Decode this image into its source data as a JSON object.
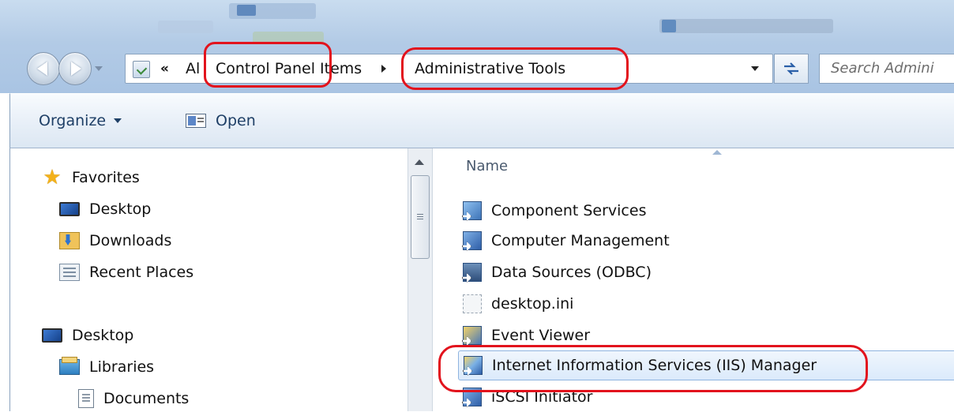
{
  "address_bar": {
    "overflow_chevron": "«",
    "crumbs": [
      "Al",
      "Control Panel Items",
      "Administrative Tools"
    ],
    "search_placeholder": "Search Admini"
  },
  "command_bar": {
    "organize_label": "Organize",
    "open_label": "Open"
  },
  "nav_pane": {
    "items": [
      {
        "label": "Favorites",
        "icon": "star-icon"
      },
      {
        "label": "Desktop",
        "icon": "desktop-icon"
      },
      {
        "label": "Downloads",
        "icon": "downloads-icon"
      },
      {
        "label": "Recent Places",
        "icon": "recent-places-icon"
      },
      {
        "label": "Desktop",
        "icon": "desktop-icon"
      },
      {
        "label": "Libraries",
        "icon": "libraries-icon"
      },
      {
        "label": "Documents",
        "icon": "documents-icon"
      }
    ]
  },
  "file_list": {
    "column_name": "Name",
    "items": [
      {
        "name": "Component Services"
      },
      {
        "name": "Computer Management"
      },
      {
        "name": "Data Sources (ODBC)"
      },
      {
        "name": "desktop.ini"
      },
      {
        "name": "Event Viewer"
      },
      {
        "name": "Internet Information Services (IIS) Manager",
        "selected": true
      },
      {
        "name": "iSCSI Initiator"
      }
    ]
  },
  "colors": {
    "highlight_marker": "#e2131d",
    "selection_bg": "#dbeafb",
    "chrome_blue": "#b3cbe6"
  }
}
